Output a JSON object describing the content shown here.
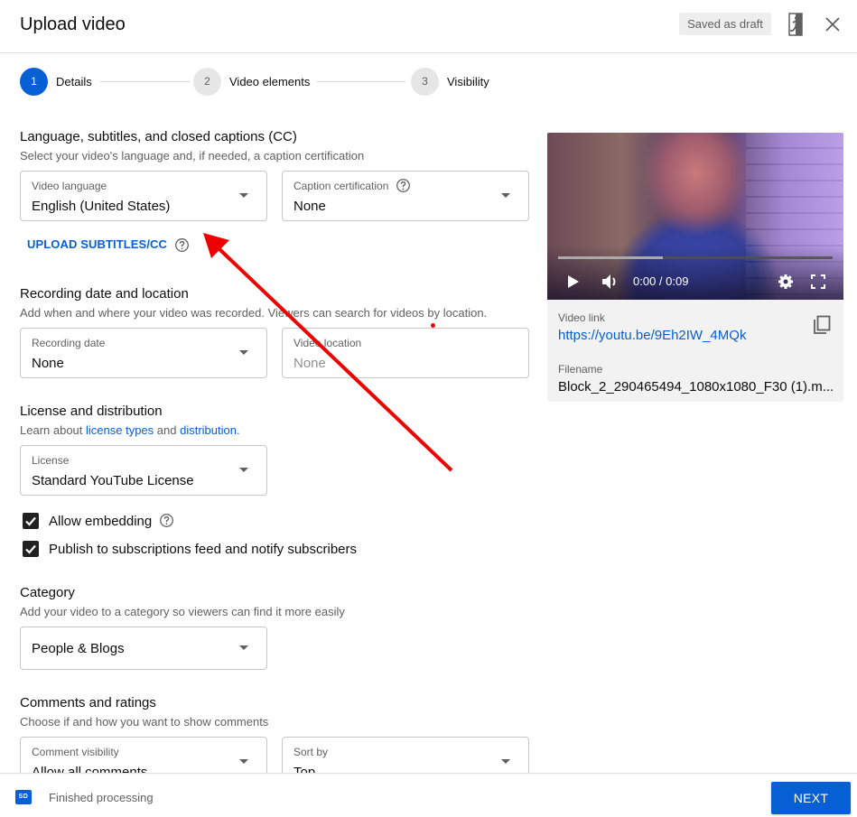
{
  "header": {
    "title": "Upload video",
    "draft_status": "Saved as draft",
    "feedback_icon": "exit-running-man-icon",
    "close_icon": "close-icon"
  },
  "stepper": {
    "steps": [
      {
        "number": "1",
        "label": "Details",
        "active": true
      },
      {
        "number": "2",
        "label": "Video elements",
        "active": false
      },
      {
        "number": "3",
        "label": "Visibility",
        "active": false
      }
    ]
  },
  "language": {
    "title": "Language, subtitles, and closed captions (CC)",
    "description": "Select your video's language and, if needed, a caption certification",
    "video_language": {
      "label": "Video language",
      "value": "English (United States)"
    },
    "caption_certification": {
      "label": "Caption certification",
      "value": "None"
    },
    "upload_subtitles": "UPLOAD SUBTITLES/CC"
  },
  "recording": {
    "title": "Recording date and location",
    "description": "Add when and where your video was recorded. Viewers can search for videos by location.",
    "recording_date": {
      "label": "Recording date",
      "value": "None"
    },
    "video_location": {
      "label": "Video location",
      "placeholder": "None"
    }
  },
  "license": {
    "title": "License and distribution",
    "desc_prefix": "Learn about ",
    "link_license_types": "license types",
    "desc_and": " and ",
    "link_distribution": "distribution",
    "desc_suffix": ".",
    "license_field": {
      "label": "License",
      "value": "Standard YouTube License"
    },
    "allow_embedding": {
      "label": "Allow embedding",
      "checked": true
    },
    "publish_feed": {
      "label": "Publish to subscriptions feed and notify subscribers",
      "checked": true
    }
  },
  "category": {
    "title": "Category",
    "description": "Add your video to a category so viewers can find it more easily",
    "value": "People & Blogs"
  },
  "comments": {
    "title": "Comments and ratings",
    "description": "Choose if and how you want to show comments",
    "comment_visibility": {
      "label": "Comment visibility",
      "value": "Allow all comments"
    },
    "sort_by": {
      "label": "Sort by",
      "value": "Top"
    }
  },
  "preview": {
    "time": "0:00 / 0:09",
    "buffered_fraction": 0.38,
    "video_link_label": "Video link",
    "video_link": "https://youtu.be/9Eh2IW_4MQk",
    "filename_label": "Filename",
    "filename": "Block_2_290465494_1080x1080_F30 (1).m..."
  },
  "footer": {
    "badge": "SD",
    "status": "Finished processing",
    "next_label": "NEXT"
  },
  "colors": {
    "accent": "#065fd4",
    "annotation": "#ee0000"
  }
}
